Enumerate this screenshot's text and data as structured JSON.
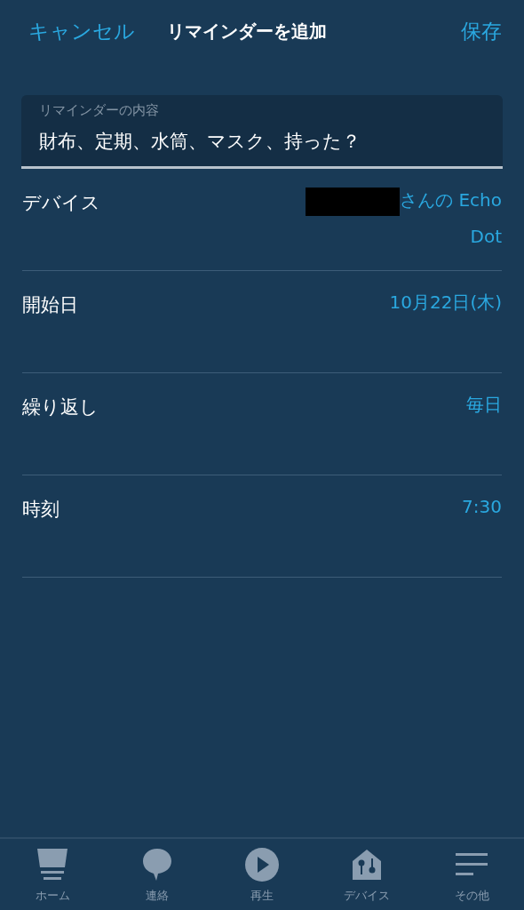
{
  "header": {
    "cancel": "キャンセル",
    "title": "リマインダーを追加",
    "save": "保存"
  },
  "reminder_field": {
    "label": "リマインダーの内容",
    "value": "財布、定期、水筒、マスク、持った？"
  },
  "settings": [
    {
      "label": "デバイス",
      "value": "さんの Echo Dot",
      "redacted": true
    },
    {
      "label": "開始日",
      "value": "10月22日(木)",
      "redacted": false
    },
    {
      "label": "繰り返し",
      "value": "毎日",
      "redacted": false
    },
    {
      "label": "時刻",
      "value": "7:30",
      "redacted": false
    }
  ],
  "tab_bar": [
    {
      "label": "ホーム"
    },
    {
      "label": "連絡"
    },
    {
      "label": "再生"
    },
    {
      "label": "デバイス"
    },
    {
      "label": "その他"
    }
  ]
}
